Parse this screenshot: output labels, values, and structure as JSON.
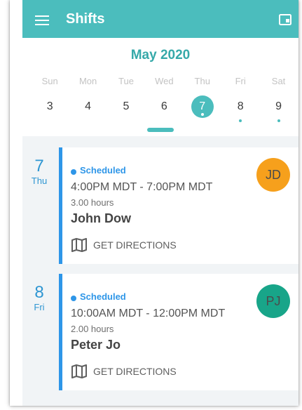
{
  "app_bar": {
    "title": "Shifts",
    "icons": [
      "menu-icon",
      "calendar-view-icon"
    ]
  },
  "calendar": {
    "month": "May 2020",
    "weekdays": [
      "Sun",
      "Mon",
      "Tue",
      "Wed",
      "Thu",
      "Fri",
      "Sat"
    ],
    "dates": [
      "3",
      "4",
      "5",
      "6",
      "7",
      "8",
      "9"
    ],
    "selected_date": "7",
    "dates_with_events": [
      "7",
      "8",
      "9"
    ]
  },
  "shifts": [
    {
      "day_number": "7",
      "day_name": "Thu",
      "status": "Scheduled",
      "time_range": "4:00PM MDT - 7:00PM MDT",
      "duration": "3.00 hours",
      "employee": "John Dow",
      "initials": "JD",
      "avatar_color": "#f6a01c",
      "directions_label": "GET DIRECTIONS"
    },
    {
      "day_number": "8",
      "day_name": "Fri",
      "status": "Scheduled",
      "time_range": "10:00AM MDT - 12:00PM MDT",
      "duration": "2.00 hours",
      "employee": "Peter Jo",
      "initials": "PJ",
      "avatar_color": "#18a589",
      "directions_label": "GET DIRECTIONS"
    }
  ],
  "colors": {
    "app_bar": "#4bbdbd",
    "accent_blue": "#2e96e8",
    "month_text": "#36a9a9",
    "content_background": "#f1f4f6"
  }
}
